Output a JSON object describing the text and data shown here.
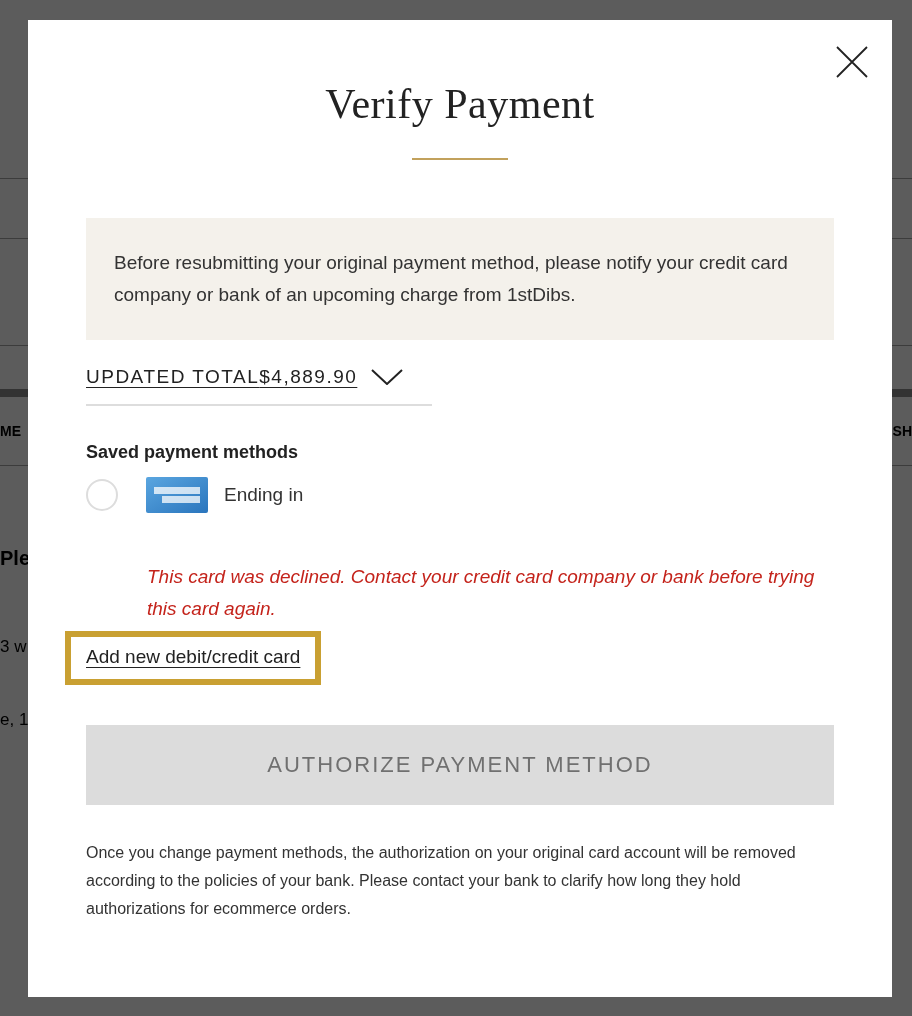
{
  "background": {
    "rows": [
      {
        "left": "ME",
        "right": "SH",
        "kind": "tabs"
      },
      {
        "left": "Ple",
        "kind": "heading"
      },
      {
        "left": "3 w",
        "kind": "text"
      },
      {
        "left": "e, 1",
        "kind": "text"
      }
    ]
  },
  "modal": {
    "title": "Verify Payment",
    "notice": "Before resubmitting your original payment method, please notify your credit card company or bank of an upcoming charge from 1stDibs.",
    "total": {
      "label": "UPDATED TOTAL",
      "amount": "$4,889.90",
      "expanded": false
    },
    "saved_heading": "Saved payment methods",
    "methods": [
      {
        "label": "Ending in",
        "selected": false
      }
    ],
    "error": "This card was declined. Contact your credit card company or bank before trying this card again.",
    "add_card_link": {
      "label": "Add new debit/credit card",
      "focused": true
    },
    "authorize_button": {
      "label": "AUTHORIZE PAYMENT METHOD",
      "disabled": true
    },
    "footnote": "Once you change payment methods, the authorization on your original card account will be removed according to the policies of your bank. Please contact your bank to clarify how long they hold authorizations for ecommerce orders."
  }
}
